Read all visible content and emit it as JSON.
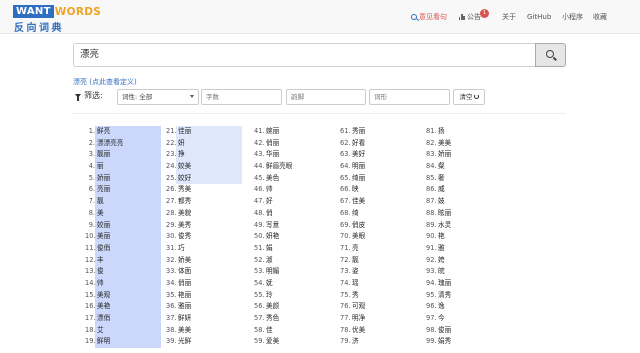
{
  "logo": {
    "want": "WANT",
    "words": "WORDS",
    "chinese": "反向词典"
  },
  "nav": {
    "feedback": "意见看句",
    "notice": "公告",
    "notice_badge": "1",
    "about": "关于",
    "github": "GitHub",
    "miniprogram": "小程序",
    "favorite": "收藏"
  },
  "search": {
    "value": "漂亮"
  },
  "definition_link": "漂亮 (点此查看定义)",
  "filters": {
    "label": "筛选:",
    "pos_select": "词性: 全部",
    "chars_placeholder": "字数",
    "rhyme_placeholder": "韵脚",
    "form_placeholder": "词形",
    "clear_label": "清空"
  },
  "columns": [
    [
      {
        "n": "1.",
        "w": "鲜亮",
        "hl": 1
      },
      {
        "n": "2.",
        "w": "漂漂亮亮",
        "hl": 1
      },
      {
        "n": "3.",
        "w": "靓丽",
        "hl": 1
      },
      {
        "n": "4.",
        "w": "丽",
        "hl": 1
      },
      {
        "n": "5.",
        "w": "娇丽",
        "hl": 1
      },
      {
        "n": "6.",
        "w": "亮丽",
        "hl": 1
      },
      {
        "n": "7.",
        "w": "靓",
        "hl": 1
      },
      {
        "n": "8.",
        "w": "美",
        "hl": 1
      },
      {
        "n": "9.",
        "w": "姣丽",
        "hl": 1
      },
      {
        "n": "10.",
        "w": "美丽",
        "hl": 1
      },
      {
        "n": "11.",
        "w": "俊俏",
        "hl": 1
      },
      {
        "n": "12.",
        "w": "丰",
        "hl": 1
      },
      {
        "n": "13.",
        "w": "俊",
        "hl": 1
      },
      {
        "n": "14.",
        "w": "帅",
        "hl": 1
      },
      {
        "n": "15.",
        "w": "美观",
        "hl": 1
      },
      {
        "n": "16.",
        "w": "美艳",
        "hl": 1
      },
      {
        "n": "17.",
        "w": "漂俏",
        "hl": 1
      },
      {
        "n": "18.",
        "w": "艾",
        "hl": 1
      },
      {
        "n": "19.",
        "w": "鲜明",
        "hl": 1
      }
    ],
    [
      {
        "n": "21.",
        "w": "佳丽",
        "hl": 2
      },
      {
        "n": "22.",
        "w": "妍",
        "hl": 2
      },
      {
        "n": "23.",
        "w": "挣",
        "hl": 2
      },
      {
        "n": "24.",
        "w": "姣美",
        "hl": 2
      },
      {
        "n": "25.",
        "w": "姣好",
        "hl": 2
      },
      {
        "n": "26.",
        "w": "秀美",
        "hl": 0
      },
      {
        "n": "27.",
        "w": "都秀",
        "hl": 0
      },
      {
        "n": "28.",
        "w": "美貌",
        "hl": 0
      },
      {
        "n": "29.",
        "w": "美秀",
        "hl": 0
      },
      {
        "n": "30.",
        "w": "俊秀",
        "hl": 0
      },
      {
        "n": "31.",
        "w": "巧",
        "hl": 0
      },
      {
        "n": "32.",
        "w": "娇美",
        "hl": 0
      },
      {
        "n": "33.",
        "w": "体面",
        "hl": 0
      },
      {
        "n": "34.",
        "w": "俏丽",
        "hl": 0
      },
      {
        "n": "35.",
        "w": "艳丽",
        "hl": 0
      },
      {
        "n": "36.",
        "w": "雅丽",
        "hl": 0
      },
      {
        "n": "37.",
        "w": "鲜妍",
        "hl": 0
      },
      {
        "n": "38.",
        "w": "美美",
        "hl": 0
      },
      {
        "n": "39.",
        "w": "光鲜",
        "hl": 0
      }
    ],
    [
      {
        "n": "41.",
        "w": "婉丽",
        "hl": 0
      },
      {
        "n": "42.",
        "w": "俏丽",
        "hl": 0
      },
      {
        "n": "43.",
        "w": "华丽",
        "hl": 0
      },
      {
        "n": "44.",
        "w": "鲜眉亮眼",
        "hl": 0
      },
      {
        "n": "45.",
        "w": "美色",
        "hl": 0
      },
      {
        "n": "46.",
        "w": "帅",
        "hl": 0
      },
      {
        "n": "47.",
        "w": "好",
        "hl": 0
      },
      {
        "n": "48.",
        "w": "俏",
        "hl": 0
      },
      {
        "n": "49.",
        "w": "写意",
        "hl": 0
      },
      {
        "n": "50.",
        "w": "妍艳",
        "hl": 0
      },
      {
        "n": "51.",
        "w": "娟",
        "hl": 0
      },
      {
        "n": "52.",
        "w": "淑",
        "hl": 0
      },
      {
        "n": "53.",
        "w": "明媚",
        "hl": 0
      },
      {
        "n": "54.",
        "w": "妩",
        "hl": 0
      },
      {
        "n": "55.",
        "w": "玲",
        "hl": 0
      },
      {
        "n": "56.",
        "w": "美颜",
        "hl": 0
      },
      {
        "n": "57.",
        "w": "秀色",
        "hl": 0
      },
      {
        "n": "58.",
        "w": "佳",
        "hl": 0
      },
      {
        "n": "59.",
        "w": "爱美",
        "hl": 0
      }
    ],
    [
      {
        "n": "61.",
        "w": "秀丽",
        "hl": 0
      },
      {
        "n": "62.",
        "w": "好看",
        "hl": 0
      },
      {
        "n": "63.",
        "w": "美好",
        "hl": 0
      },
      {
        "n": "64.",
        "w": "明丽",
        "hl": 0
      },
      {
        "n": "65.",
        "w": "绮丽",
        "hl": 0
      },
      {
        "n": "66.",
        "w": "映",
        "hl": 0
      },
      {
        "n": "67.",
        "w": "佳美",
        "hl": 0
      },
      {
        "n": "68.",
        "w": "绮",
        "hl": 0
      },
      {
        "n": "69.",
        "w": "俏皮",
        "hl": 0
      },
      {
        "n": "70.",
        "w": "美眼",
        "hl": 0
      },
      {
        "n": "71.",
        "w": "亮",
        "hl": 0
      },
      {
        "n": "72.",
        "w": "靓",
        "hl": 0
      },
      {
        "n": "73.",
        "w": "姿",
        "hl": 0
      },
      {
        "n": "74.",
        "w": "瑶",
        "hl": 0
      },
      {
        "n": "75.",
        "w": "秀",
        "hl": 0
      },
      {
        "n": "76.",
        "w": "可观",
        "hl": 0
      },
      {
        "n": "77.",
        "w": "明净",
        "hl": 0
      },
      {
        "n": "78.",
        "w": "优美",
        "hl": 0
      },
      {
        "n": "79.",
        "w": "济",
        "hl": 0
      }
    ],
    [
      {
        "n": "81.",
        "w": "扬",
        "hl": 0
      },
      {
        "n": "82.",
        "w": "美美",
        "hl": 0
      },
      {
        "n": "83.",
        "w": "娇丽",
        "hl": 0
      },
      {
        "n": "84.",
        "w": "粲",
        "hl": 0
      },
      {
        "n": "85.",
        "w": "奢",
        "hl": 0
      },
      {
        "n": "86.",
        "w": "威",
        "hl": 0
      },
      {
        "n": "87.",
        "w": "妓",
        "hl": 0
      },
      {
        "n": "88.",
        "w": "眩丽",
        "hl": 0
      },
      {
        "n": "89.",
        "w": "水灵",
        "hl": 0
      },
      {
        "n": "90.",
        "w": "艳",
        "hl": 0
      },
      {
        "n": "91.",
        "w": "雅",
        "hl": 0
      },
      {
        "n": "92.",
        "w": "姱",
        "hl": 0
      },
      {
        "n": "93.",
        "w": "皖",
        "hl": 0
      },
      {
        "n": "94.",
        "w": "瑰丽",
        "hl": 0
      },
      {
        "n": "95.",
        "w": "清秀",
        "hl": 0
      },
      {
        "n": "96.",
        "w": "逸",
        "hl": 0
      },
      {
        "n": "97.",
        "w": "今",
        "hl": 0
      },
      {
        "n": "98.",
        "w": "俊丽",
        "hl": 0
      },
      {
        "n": "99.",
        "w": "娟秀",
        "hl": 0
      }
    ]
  ],
  "colors": {
    "brand_blue": "#2f6fc0",
    "brand_orange": "#f0a323",
    "highlight_strong": "#cbd8fb",
    "highlight_light": "#dfe7fc",
    "alert_red": "#d9534f"
  }
}
